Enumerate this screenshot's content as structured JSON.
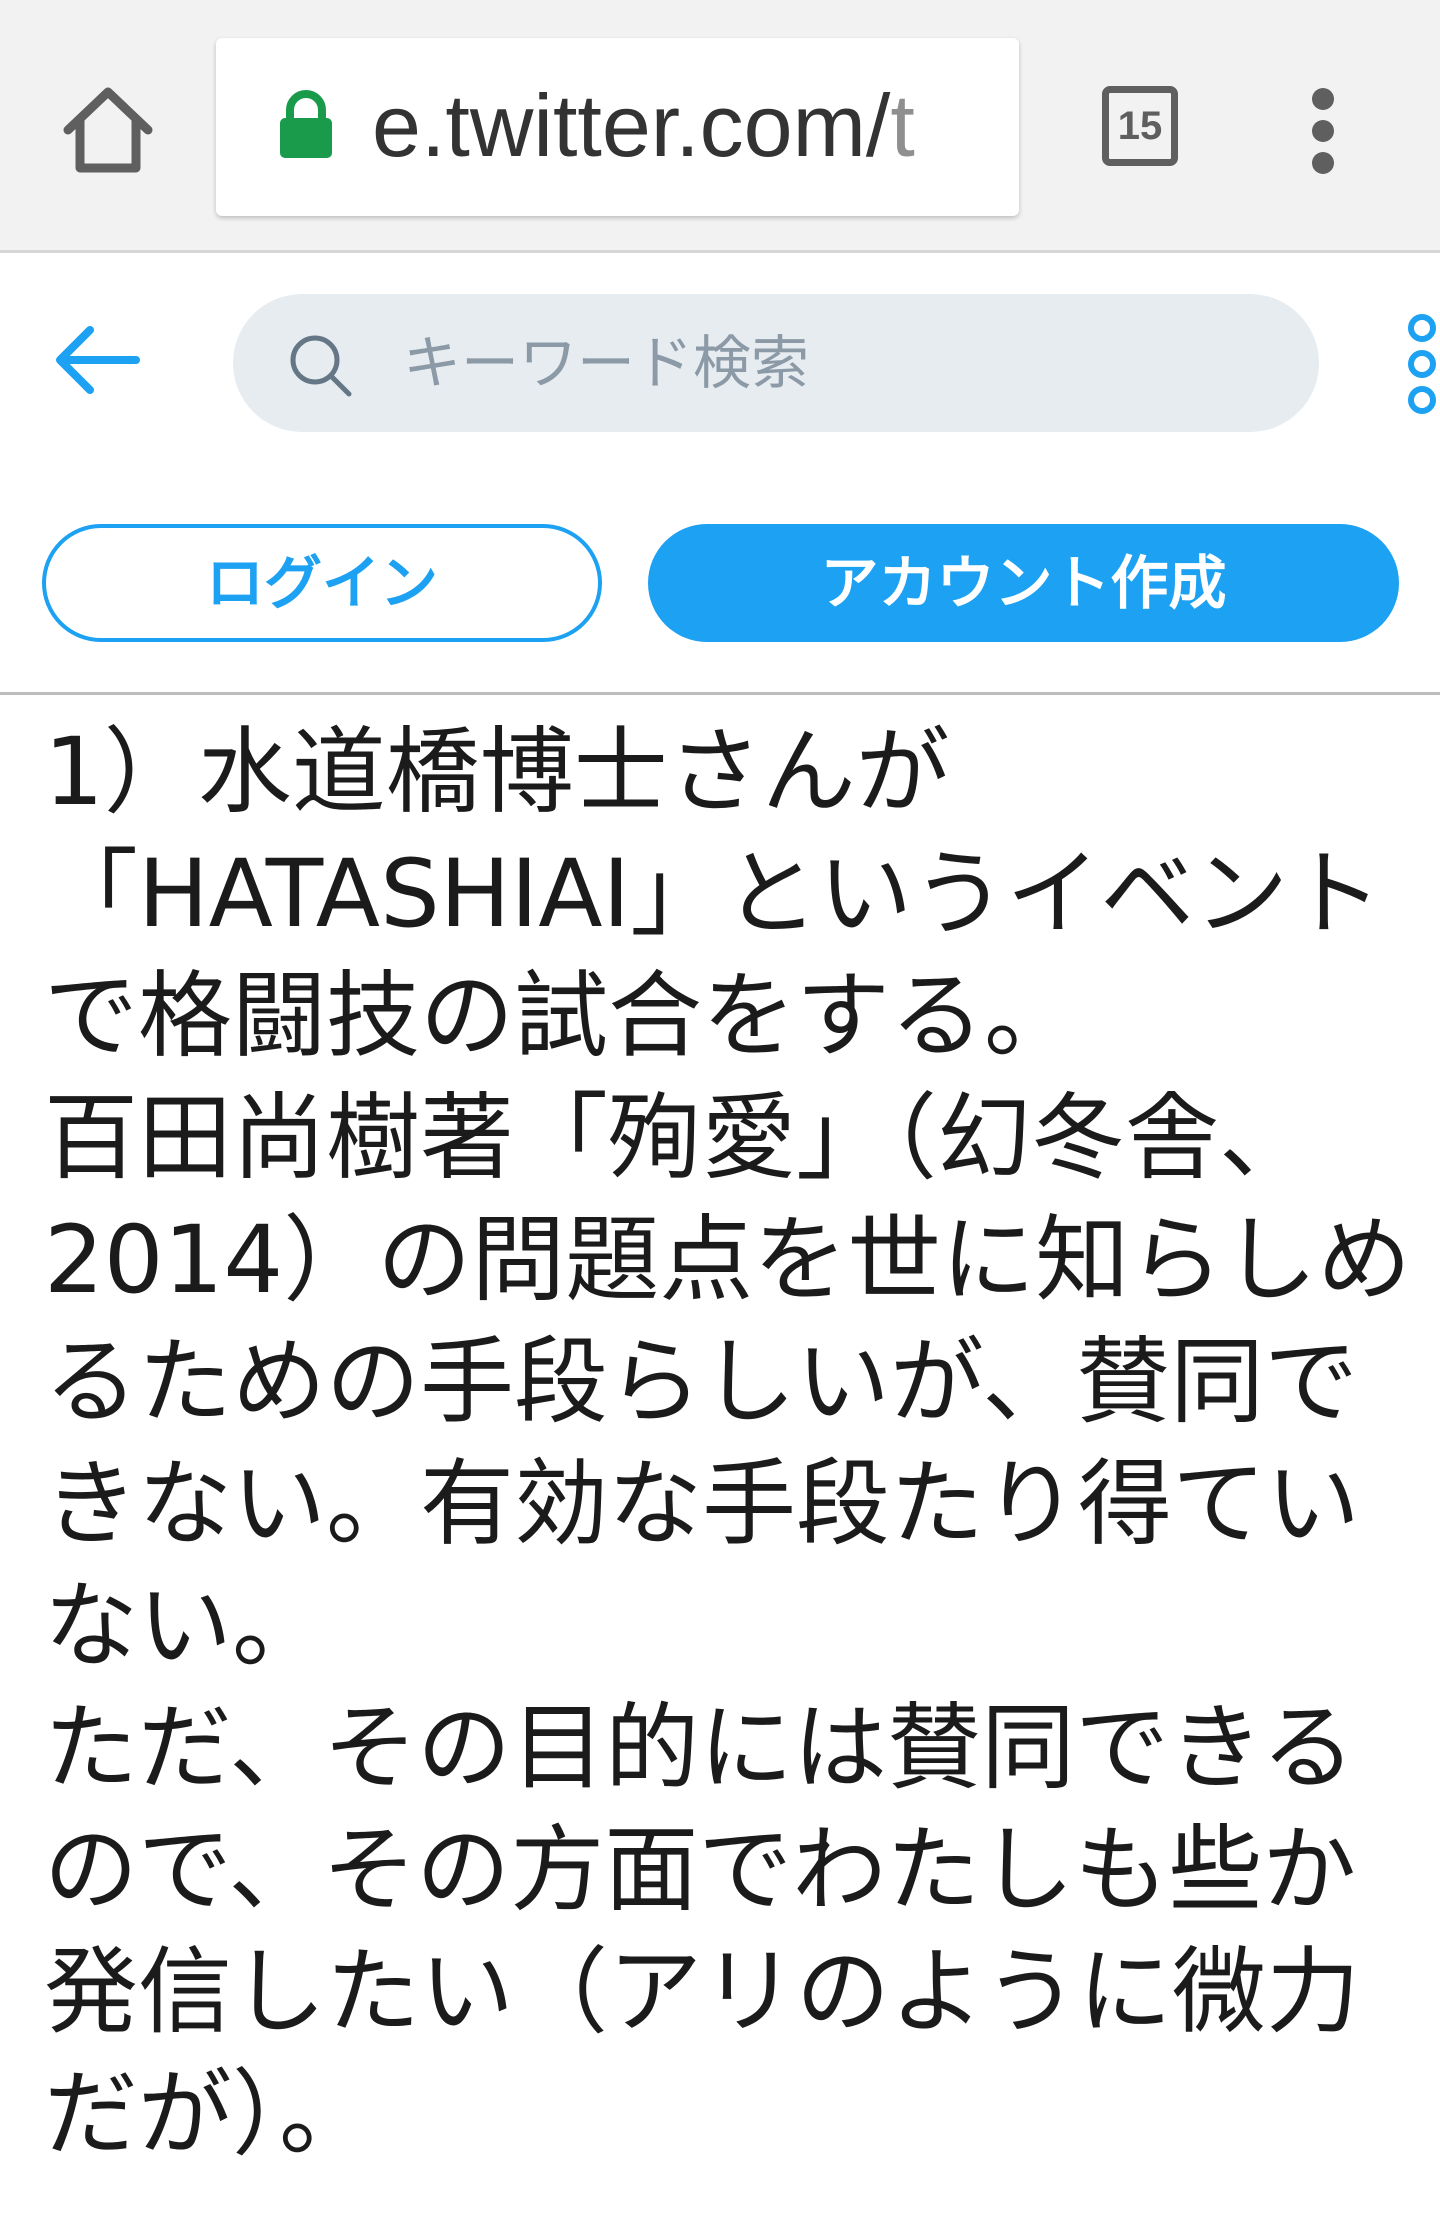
{
  "browser": {
    "url_main": "e.twitter.com/",
    "url_tail": "t",
    "tab_count": "15",
    "icons": {
      "home": "home-icon",
      "lock": "lock-icon",
      "tabs": "tab-switcher-icon",
      "menu": "overflow-menu-icon"
    },
    "colors": {
      "lock": "#1a9b4b",
      "chrome_bg": "#f2f2f2"
    }
  },
  "header": {
    "search_placeholder": "キーワード検索",
    "login_label": "ログイン",
    "signup_label": "アカウント作成",
    "colors": {
      "accent": "#1da1f2",
      "search_bg": "#e6ecf0"
    }
  },
  "tweet": {
    "lines": [
      "1）水道橋博士さんが",
      "「HATASHIAI」というイベント",
      "で格闘技の試合をする。",
      "百田尚樹著「殉愛」（幻冬舎、",
      "2014）の問題点を世に知らしめ",
      "るための手段らしいが、賛同で",
      "きない。有効な手段たり得てい",
      "ない。",
      "ただ、その目的には賛同できる",
      "ので、その方面でわたしも些か",
      "発信したい（アリのように微力",
      "だが）。"
    ]
  }
}
